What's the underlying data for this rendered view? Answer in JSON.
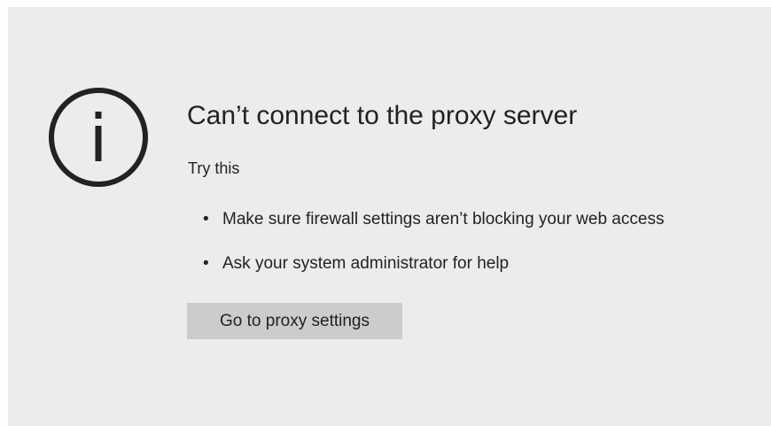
{
  "error": {
    "icon": "info-circle-icon",
    "title": "Can’t connect to the proxy server",
    "subtitle": "Try this",
    "suggestions": [
      "Make sure firewall settings aren’t blocking your web access",
      "Ask your system administrator for help"
    ],
    "bullet": "•",
    "button_label": "Go to proxy settings"
  },
  "colors": {
    "background": "#ececec",
    "text": "#222222",
    "button": "#cccccc"
  }
}
